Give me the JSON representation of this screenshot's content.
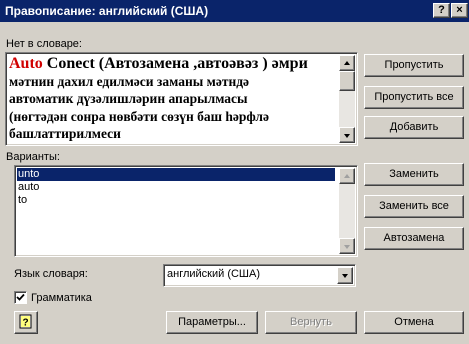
{
  "window": {
    "title": "Правописание: английский (США)",
    "help_button": "?",
    "close_button": "×"
  },
  "not_in_dict": {
    "label": "Нет в словаре:",
    "error_word": "Auto",
    "first_line_rest": " Conect (Автозамена ,автоәвәз ) әмри",
    "lines": [
      "мәтнин дахил едилмәси заманы мәтндә",
      "автоматик дүзәлишләрин апарылмасы",
      "(нөгтәдән сонра нөвбәти сөзүн баш һәрфлә",
      "башлаттирилмеси"
    ]
  },
  "buttons": {
    "skip": "Пропустить",
    "skip_all": "Пропустить все",
    "add": "Добавить",
    "replace": "Заменить",
    "replace_all": "Заменить все",
    "autocorrect": "Автозамена",
    "options": "Параметры...",
    "undo": "Вернуть",
    "cancel": "Отмена"
  },
  "suggestions": {
    "label": "Варианты:",
    "items": [
      "unto",
      "auto",
      "to"
    ],
    "selected_index": 0
  },
  "dictionary": {
    "label": "Язык словаря:",
    "value": "английский (США)"
  },
  "grammar": {
    "label": "Грамматика",
    "checked": true
  },
  "colors": {
    "title_bar": "#0a246a",
    "error_word": "#d00000",
    "selection": "#0a246a"
  }
}
